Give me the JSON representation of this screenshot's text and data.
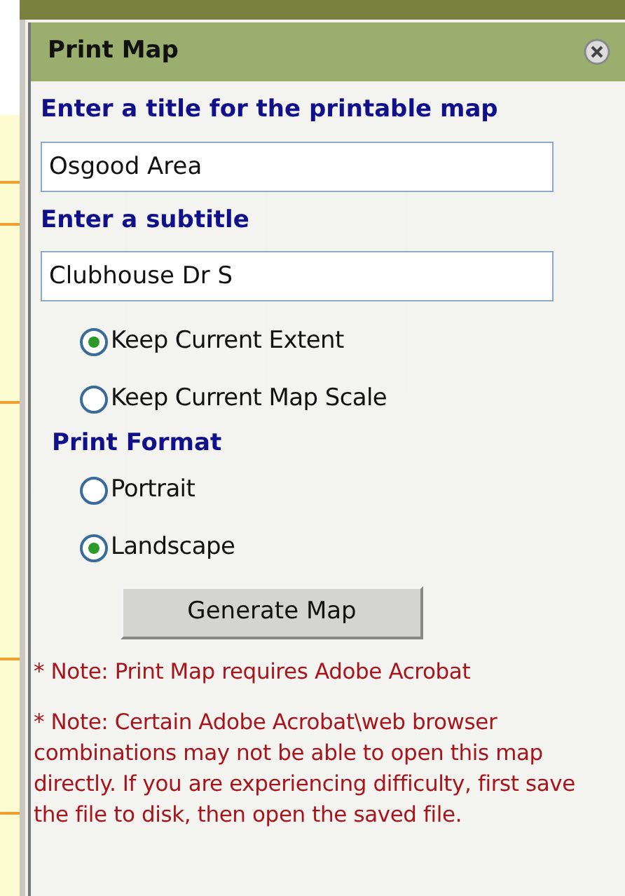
{
  "dialog": {
    "title": "Print Map"
  },
  "title_field": {
    "label": "Enter a title for the printable map",
    "value": "Osgood Area"
  },
  "subtitle_field": {
    "label": "Enter a subtitle",
    "value": "Clubhouse Dr S"
  },
  "extent_options": [
    {
      "label": "Keep Current Extent",
      "selected": true
    },
    {
      "label": "Keep Current Map Scale",
      "selected": false
    }
  ],
  "print_format": {
    "label": "Print Format",
    "options": [
      {
        "label": "Portrait",
        "selected": false
      },
      {
        "label": "Landscape",
        "selected": true
      }
    ]
  },
  "button": "Generate Map",
  "notes": [
    "* Note: Print Map requires Adobe Acrobat",
    "* Note: Certain Adobe Acrobat\\web browser combinations may not be able to open this map directly. If you are experiencing difficulty, first save the file to disk, then open the saved file."
  ]
}
